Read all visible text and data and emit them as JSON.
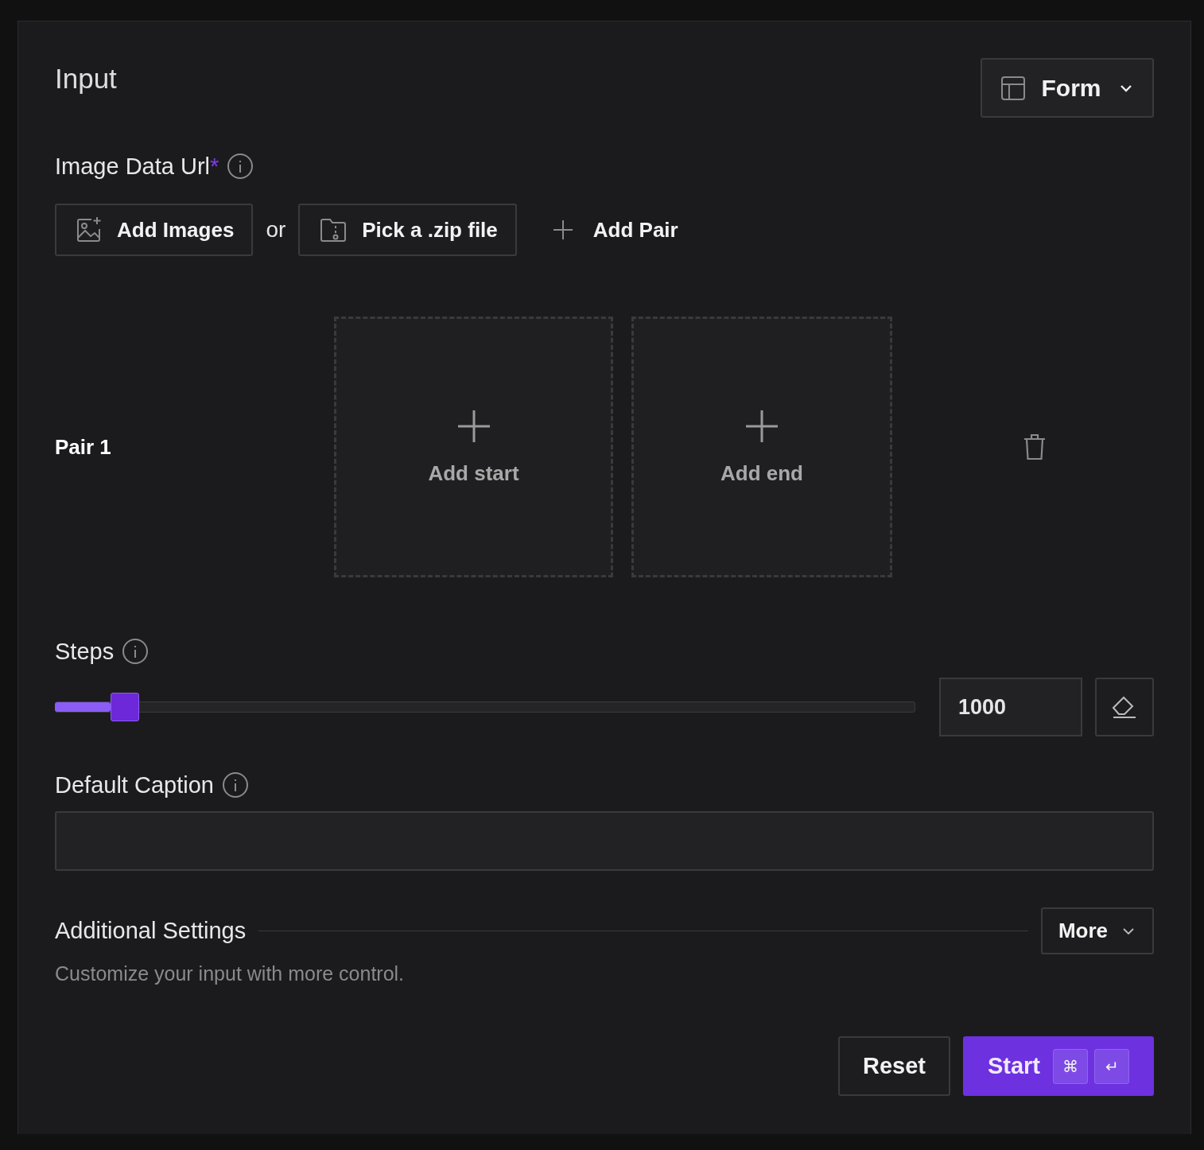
{
  "title": "Input",
  "view_menu": {
    "label": "Form"
  },
  "image_field": {
    "label": "Image Data Url",
    "required_mark": "*",
    "add_images": "Add Images",
    "separator": "or",
    "pick_zip": "Pick a .zip file",
    "add_pair": "Add Pair"
  },
  "pairs": [
    {
      "label": "Pair 1",
      "start": "Add start",
      "end": "Add end"
    }
  ],
  "steps": {
    "label": "Steps",
    "level": 0.065,
    "value": "1000"
  },
  "caption": {
    "label": "Default Caption"
  },
  "additional": {
    "title": "Additional Settings",
    "more": "More",
    "description": "Customize your input with more control."
  },
  "actions": {
    "reset": "Reset",
    "start": "Start",
    "keys": [
      "⌘",
      "↵"
    ]
  }
}
